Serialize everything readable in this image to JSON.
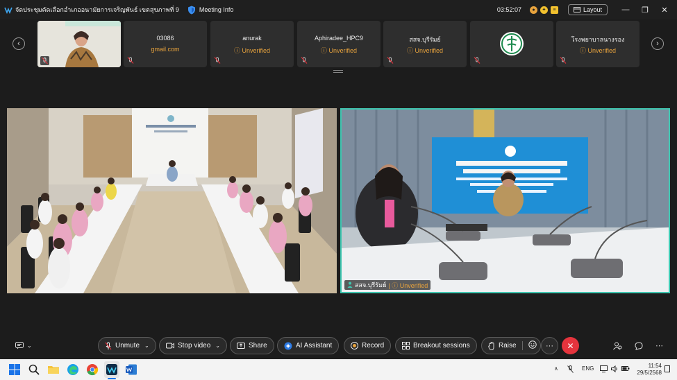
{
  "window": {
    "title": "จัดประชุมคัดเลือกอำเภออนามัยการเจริญพันธ์ เขตสุขภาพที่ 9",
    "meeting_info": "Meeting Info",
    "timer": "03:52:07",
    "layout_label": "Layout"
  },
  "participants": [
    {
      "name": "",
      "sub": "",
      "type": "video"
    },
    {
      "name": "03086",
      "sub": "gmail.com",
      "type": "text"
    },
    {
      "name": "anurak",
      "sub": "Unverified",
      "type": "unverified"
    },
    {
      "name": "Aphiradee_HPC9",
      "sub": "Unverified",
      "type": "unverified"
    },
    {
      "name": "สสจ.บุรีรัมย์",
      "sub": "Unverified",
      "type": "unverified"
    },
    {
      "name": "",
      "sub": "",
      "type": "logo"
    },
    {
      "name": "โรงพยาบาลนางรอง",
      "sub": "Unverified",
      "type": "unverified"
    }
  ],
  "main_video": {
    "speaker_name": "สสจ.บุรีรัมย์",
    "speaker_status": "Unverified"
  },
  "toolbar": {
    "unmute": "Unmute",
    "stop_video": "Stop video",
    "share": "Share",
    "ai_assistant": "AI Assistant",
    "record": "Record",
    "breakout": "Breakout sessions",
    "raise": "Raise",
    "more": "···"
  },
  "taskbar": {
    "lang": "ENG",
    "time": "11:54",
    "date": "29/5/2568"
  },
  "colors": {
    "accent_teal": "#3fc6b0",
    "unverified": "#e8a33d",
    "end_red": "#e5343d"
  }
}
